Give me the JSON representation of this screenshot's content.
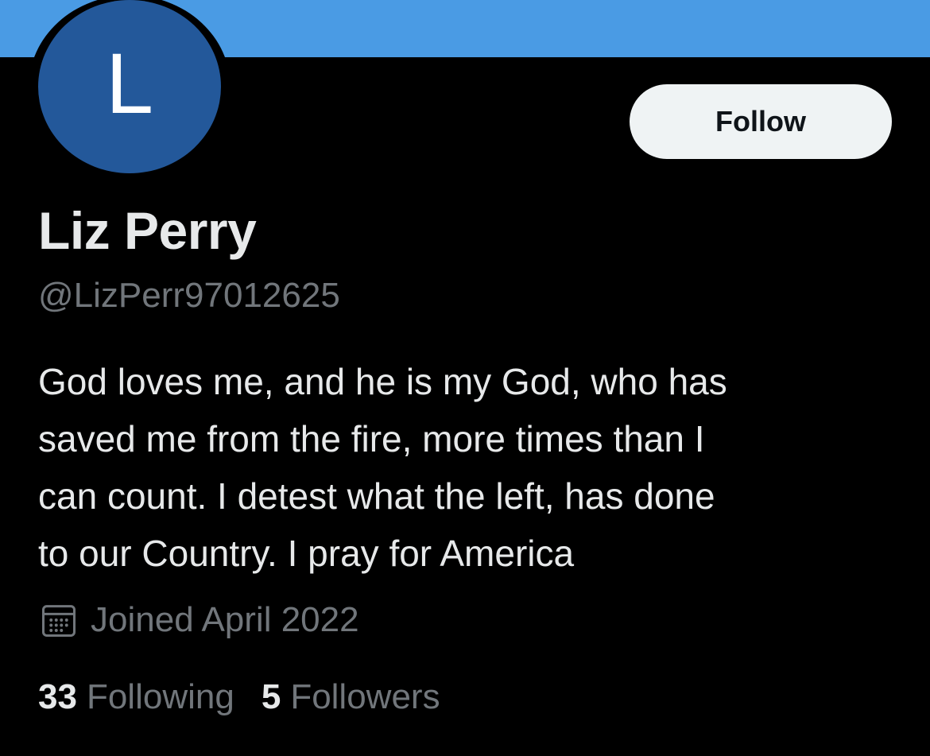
{
  "profile": {
    "avatar_initial": "L",
    "display_name": "Liz Perry",
    "handle": "@LizPerr97012625",
    "bio_lines": [
      "God loves me, and he is my God, who has",
      "saved me from the fire, more times than I",
      "can count. I detest what the left, has done",
      "to our Country. I pray for America"
    ],
    "joined": "Joined April 2022",
    "joined_icon": "calendar-icon",
    "following_count": "33",
    "following_label": "Following",
    "followers_count": "5",
    "followers_label": "Followers"
  },
  "actions": {
    "follow_label": "Follow"
  },
  "colors": {
    "banner": "#4a9be4",
    "avatar_bg": "#23589a",
    "background": "#000000",
    "primary_text": "#e7e9ea",
    "secondary_text": "#71767b",
    "follow_button_bg": "#eff3f4"
  }
}
